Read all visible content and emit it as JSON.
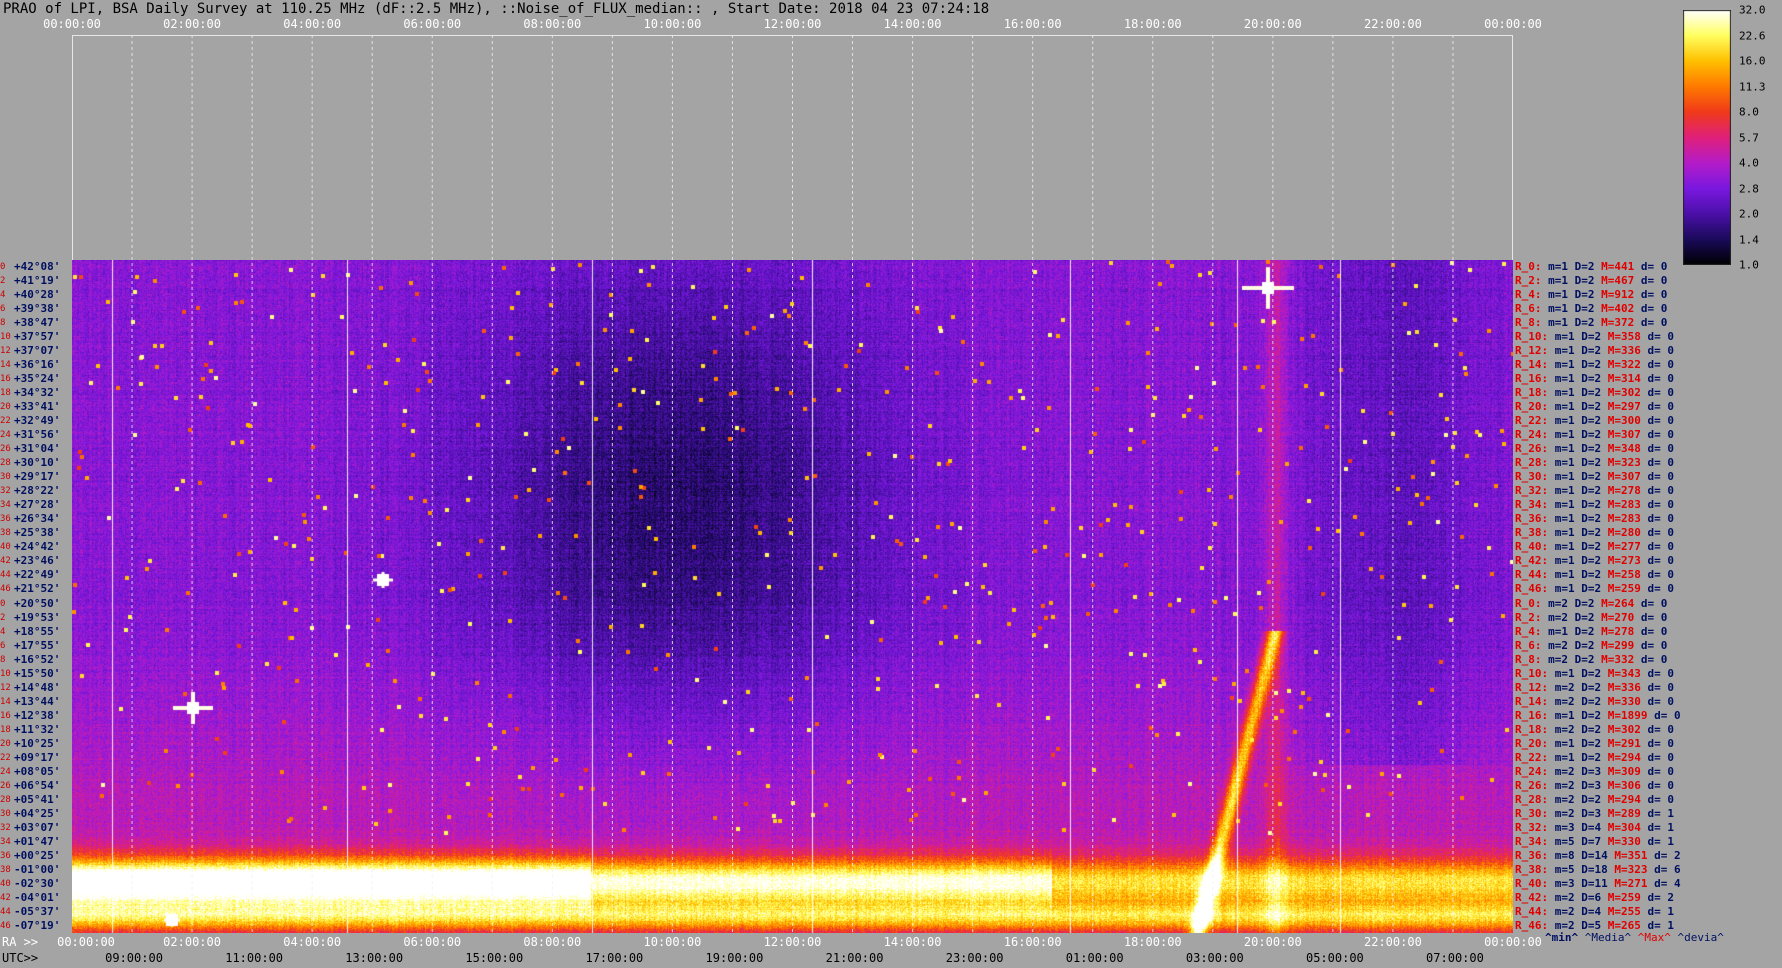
{
  "title": "PRAO of LPI, BSA Daily Survey at 110.25 MHz (dF::2.5 MHz), ::Noise_of_FLUX_median:: , Start Date: 2018 04 23 07:24:18",
  "top_ticks": [
    "00:00:00",
    "02:00:00",
    "04:00:00",
    "06:00:00",
    "08:00:00",
    "10:00:00",
    "12:00:00",
    "14:00:00",
    "16:00:00",
    "18:00:00",
    "20:00:00",
    "22:00:00",
    "00:00:00"
  ],
  "ra_prefix": "RA >>",
  "ra_ticks": [
    "00:00:00",
    "02:00:00",
    "04:00:00",
    "06:00:00",
    "08:00:00",
    "10:00:00",
    "12:00:00",
    "14:00:00",
    "16:00:00",
    "18:00:00",
    "20:00:00",
    "22:00:00",
    "00:00:00"
  ],
  "utc_prefix": "UTC>>",
  "utc_ticks": [
    "09:00:00",
    "11:00:00",
    "13:00:00",
    "15:00:00",
    "17:00:00",
    "19:00:00",
    "21:00:00",
    "23:00:00",
    "01:00:00",
    "03:00:00",
    "05:00:00",
    "07:00:00"
  ],
  "colorbar": {
    "ticks": [
      "32.0",
      "22.6",
      "16.0",
      "11.3",
      "8.0",
      "5.7",
      "4.0",
      "2.8",
      "2.0",
      "1.4",
      "1.0"
    ],
    "colors": [
      "#000000",
      "#1a0a5a",
      "#4b10a8",
      "#7a18e0",
      "#b41cc8",
      "#e0207a",
      "#f03a1a",
      "#ff7a00",
      "#ffc000",
      "#ffff60",
      "#ffffff"
    ]
  },
  "declinations": [
    {
      "idx": "0",
      "dec": "+42°08'"
    },
    {
      "idx": "2",
      "dec": "+41°19'"
    },
    {
      "idx": "4",
      "dec": "+40°28'"
    },
    {
      "idx": "6",
      "dec": "+39°38'"
    },
    {
      "idx": "8",
      "dec": "+38°47'"
    },
    {
      "idx": "10",
      "dec": "+37°57'"
    },
    {
      "idx": "12",
      "dec": "+37°07'"
    },
    {
      "idx": "14",
      "dec": "+36°16'"
    },
    {
      "idx": "16",
      "dec": "+35°24'"
    },
    {
      "idx": "18",
      "dec": "+34°32'"
    },
    {
      "idx": "20",
      "dec": "+33°41'"
    },
    {
      "idx": "22",
      "dec": "+32°49'"
    },
    {
      "idx": "24",
      "dec": "+31°56'"
    },
    {
      "idx": "26",
      "dec": "+31°04'"
    },
    {
      "idx": "28",
      "dec": "+30°10'"
    },
    {
      "idx": "30",
      "dec": "+29°17'"
    },
    {
      "idx": "32",
      "dec": "+28°22'"
    },
    {
      "idx": "34",
      "dec": "+27°28'"
    },
    {
      "idx": "36",
      "dec": "+26°34'"
    },
    {
      "idx": "38",
      "dec": "+25°38'"
    },
    {
      "idx": "40",
      "dec": "+24°42'"
    },
    {
      "idx": "42",
      "dec": "+23°46'"
    },
    {
      "idx": "44",
      "dec": "+22°49'"
    },
    {
      "idx": "46",
      "dec": "+21°52'"
    },
    {
      "idx": "0",
      "dec": "+20°50'"
    },
    {
      "idx": "2",
      "dec": "+19°53'"
    },
    {
      "idx": "4",
      "dec": "+18°55'"
    },
    {
      "idx": "6",
      "dec": "+17°55'"
    },
    {
      "idx": "8",
      "dec": "+16°52'"
    },
    {
      "idx": "10",
      "dec": "+15°50'"
    },
    {
      "idx": "12",
      "dec": "+14°48'"
    },
    {
      "idx": "14",
      "dec": "+13°44'"
    },
    {
      "idx": "16",
      "dec": "+12°38'"
    },
    {
      "idx": "18",
      "dec": "+11°32'"
    },
    {
      "idx": "20",
      "dec": "+10°25'"
    },
    {
      "idx": "22",
      "dec": "+09°17'"
    },
    {
      "idx": "24",
      "dec": "+08°05'"
    },
    {
      "idx": "26",
      "dec": "+06°54'"
    },
    {
      "idx": "28",
      "dec": "+05°41'"
    },
    {
      "idx": "30",
      "dec": "+04°25'"
    },
    {
      "idx": "32",
      "dec": "+03°07'"
    },
    {
      "idx": "34",
      "dec": "+01°47'"
    },
    {
      "idx": "36",
      "dec": "+00°25'"
    },
    {
      "idx": "38",
      "dec": "-01°00'"
    },
    {
      "idx": "40",
      "dec": "-02°30'"
    },
    {
      "idx": "42",
      "dec": "-04°01'"
    },
    {
      "idx": "44",
      "dec": "-05°37'"
    },
    {
      "idx": "46",
      "dec": "-07°19'"
    }
  ],
  "stats": [
    {
      "r": "R_0:",
      "m": "m=1 D=2",
      "x": "M=441",
      "d": "d= 0"
    },
    {
      "r": "R_2:",
      "m": "m=1 D=2",
      "x": "M=467",
      "d": "d= 0"
    },
    {
      "r": "R_4:",
      "m": "m=1 D=2",
      "x": "M=912",
      "d": "d= 0"
    },
    {
      "r": "R_6:",
      "m": "m=1 D=2",
      "x": "M=402",
      "d": "d= 0"
    },
    {
      "r": "R_8:",
      "m": "m=1 D=2",
      "x": "M=372",
      "d": "d= 0"
    },
    {
      "r": "R_10:",
      "m": "m=1 D=2",
      "x": "M=358",
      "d": "d= 0"
    },
    {
      "r": "R_12:",
      "m": "m=1 D=2",
      "x": "M=336",
      "d": "d= 0"
    },
    {
      "r": "R_14:",
      "m": "m=1 D=2",
      "x": "M=322",
      "d": "d= 0"
    },
    {
      "r": "R_16:",
      "m": "m=1 D=2",
      "x": "M=314",
      "d": "d= 0"
    },
    {
      "r": "R_18:",
      "m": "m=1 D=2",
      "x": "M=302",
      "d": "d= 0"
    },
    {
      "r": "R_20:",
      "m": "m=1 D=2",
      "x": "M=297",
      "d": "d= 0"
    },
    {
      "r": "R_22:",
      "m": "m=1 D=2",
      "x": "M=300",
      "d": "d= 0"
    },
    {
      "r": "R_24:",
      "m": "m=1 D=2",
      "x": "M=307",
      "d": "d= 0"
    },
    {
      "r": "R_26:",
      "m": "m=1 D=2",
      "x": "M=348",
      "d": "d= 0"
    },
    {
      "r": "R_28:",
      "m": "m=1 D=2",
      "x": "M=323",
      "d": "d= 0"
    },
    {
      "r": "R_30:",
      "m": "m=1 D=2",
      "x": "M=307",
      "d": "d= 0"
    },
    {
      "r": "R_32:",
      "m": "m=1 D=2",
      "x": "M=278",
      "d": "d= 0"
    },
    {
      "r": "R_34:",
      "m": "m=1 D=2",
      "x": "M=283",
      "d": "d= 0"
    },
    {
      "r": "R_36:",
      "m": "m=1 D=2",
      "x": "M=283",
      "d": "d= 0"
    },
    {
      "r": "R_38:",
      "m": "m=1 D=2",
      "x": "M=280",
      "d": "d= 0"
    },
    {
      "r": "R_40:",
      "m": "m=1 D=2",
      "x": "M=277",
      "d": "d= 0"
    },
    {
      "r": "R_42:",
      "m": "m=1 D=2",
      "x": "M=273",
      "d": "d= 0"
    },
    {
      "r": "R_44:",
      "m": "m=1 D=2",
      "x": "M=258",
      "d": "d= 0"
    },
    {
      "r": "R_46:",
      "m": "m=1 D=2",
      "x": "M=259",
      "d": "d= 0"
    },
    {
      "r": "R_0:",
      "m": "m=2 D=2",
      "x": "M=264",
      "d": "d= 0"
    },
    {
      "r": "R_2:",
      "m": "m=2 D=2",
      "x": "M=270",
      "d": "d= 0"
    },
    {
      "r": "R_4:",
      "m": "m=1 D=2",
      "x": "M=278",
      "d": "d= 0"
    },
    {
      "r": "R_6:",
      "m": "m=2 D=2",
      "x": "M=299",
      "d": "d= 0"
    },
    {
      "r": "R_8:",
      "m": "m=2 D=2",
      "x": "M=332",
      "d": "d= 0"
    },
    {
      "r": "R_10:",
      "m": "m=1 D=2",
      "x": "M=343",
      "d": "d= 0"
    },
    {
      "r": "R_12:",
      "m": "m=2 D=2",
      "x": "M=336",
      "d": "d= 0"
    },
    {
      "r": "R_14:",
      "m": "m=2 D=2",
      "x": "M=330",
      "d": "d= 0"
    },
    {
      "r": "R_16:",
      "m": "m=1 D=2",
      "x": "M=1899",
      "d": "d= 0"
    },
    {
      "r": "R_18:",
      "m": "m=2 D=2",
      "x": "M=302",
      "d": "d= 0"
    },
    {
      "r": "R_20:",
      "m": "m=1 D=2",
      "x": "M=291",
      "d": "d= 0"
    },
    {
      "r": "R_22:",
      "m": "m=1 D=2",
      "x": "M=294",
      "d": "d= 0"
    },
    {
      "r": "R_24:",
      "m": "m=2 D=3",
      "x": "M=309",
      "d": "d= 0"
    },
    {
      "r": "R_26:",
      "m": "m=2 D=3",
      "x": "M=306",
      "d": "d= 0"
    },
    {
      "r": "R_28:",
      "m": "m=2 D=2",
      "x": "M=294",
      "d": "d= 0"
    },
    {
      "r": "R_30:",
      "m": "m=2 D=3",
      "x": "M=289",
      "d": "d= 1"
    },
    {
      "r": "R_32:",
      "m": "m=3 D=4",
      "x": "M=304",
      "d": "d= 1"
    },
    {
      "r": "R_34:",
      "m": "m=5 D=7",
      "x": "M=330",
      "d": "d= 1"
    },
    {
      "r": "R_36:",
      "m": "m=8 D=14",
      "x": "M=351",
      "d": "d= 2"
    },
    {
      "r": "R_38:",
      "m": "m=5 D=18",
      "x": "M=323",
      "d": "d= 6"
    },
    {
      "r": "R_40:",
      "m": "m=3 D=11",
      "x": "M=271",
      "d": "d= 4"
    },
    {
      "r": "R_42:",
      "m": "m=2 D=6",
      "x": "M=259",
      "d": "d= 2"
    },
    {
      "r": "R_44:",
      "m": "m=2 D=4",
      "x": "M=255",
      "d": "d= 1"
    },
    {
      "r": "R_46:",
      "m": "m=2 D=5",
      "x": "M=265",
      "d": "d= 1"
    }
  ],
  "stats_legend": {
    "min": "^min^",
    "media": "^Media^",
    "max": "^Max^",
    "devia": "^devia^"
  },
  "chart_data": {
    "type": "heatmap",
    "title": "PRAO of LPI, BSA Daily Survey at 110.25 MHz (dF::2.5 MHz), ::Noise_of_FLUX_median:: , Start Date: 2018 04 23 07:24:18",
    "x_axis_ra": [
      "00:00:00",
      "02:00:00",
      "04:00:00",
      "06:00:00",
      "08:00:00",
      "10:00:00",
      "12:00:00",
      "14:00:00",
      "16:00:00",
      "18:00:00",
      "20:00:00",
      "22:00:00",
      "00:00:00"
    ],
    "x_axis_utc": [
      "09:00:00",
      "11:00:00",
      "13:00:00",
      "15:00:00",
      "17:00:00",
      "19:00:00",
      "21:00:00",
      "23:00:00",
      "01:00:00",
      "03:00:00",
      "05:00:00",
      "07:00:00"
    ],
    "colorbar_range": [
      1.0,
      32.0
    ],
    "colorbar_scale": "log"
  }
}
